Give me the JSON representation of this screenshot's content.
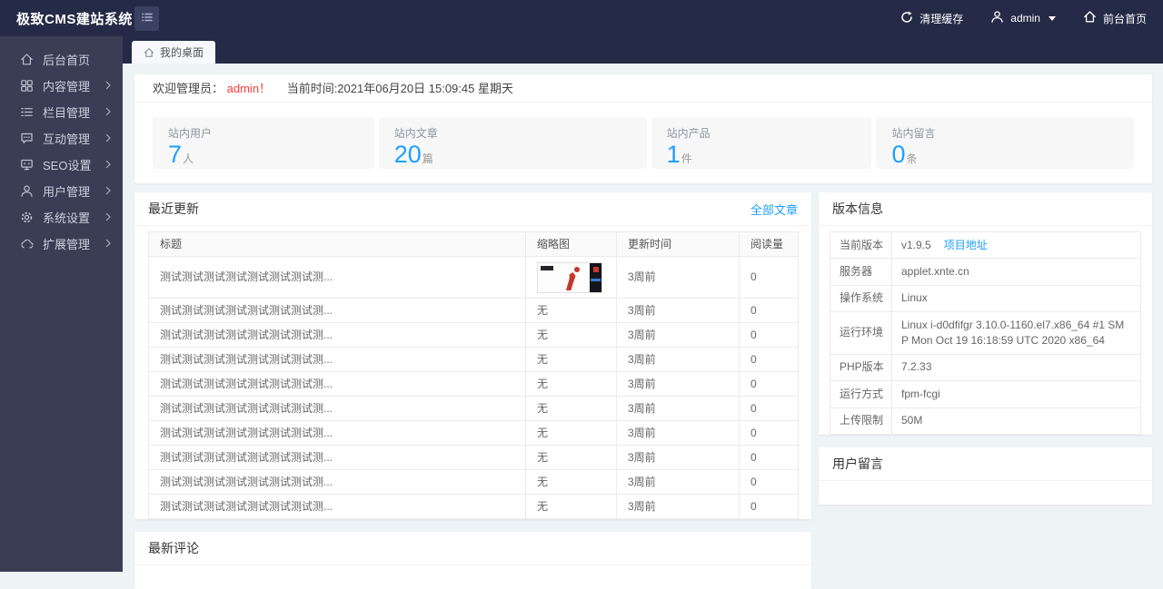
{
  "colors": {
    "accent": "#1E9FFF",
    "danger": "#ff3b3b",
    "topbar_bg": "#252a47",
    "sidebar_bg": "#3a3e54",
    "content_bg": "#eef3f6"
  },
  "topbar": {
    "logo": "极致CMS建站系统",
    "toggle_icon": "menu-list-icon",
    "clear_cache": {
      "label": "清理缓存",
      "icon": "refresh-icon"
    },
    "user": {
      "label": "admin",
      "icon": "user-icon",
      "caret": "caret-down-icon"
    },
    "front_home": {
      "label": "前台首页",
      "icon": "home-icon"
    }
  },
  "tabs": [
    {
      "label": "我的桌面",
      "icon": "home-icon"
    }
  ],
  "sidebar": {
    "items": [
      {
        "label": "后台首页",
        "icon": "home-icon",
        "has_children": false
      },
      {
        "label": "内容管理",
        "icon": "grid-icon",
        "has_children": true
      },
      {
        "label": "栏目管理",
        "icon": "list-icon",
        "has_children": true
      },
      {
        "label": "互动管理",
        "icon": "comment-icon",
        "has_children": true
      },
      {
        "label": "SEO设置",
        "icon": "monitor-icon",
        "has_children": true
      },
      {
        "label": "用户管理",
        "icon": "user-icon",
        "has_children": true
      },
      {
        "label": "系统设置",
        "icon": "gear-icon",
        "has_children": true
      },
      {
        "label": "扩展管理",
        "icon": "extension-icon",
        "has_children": true
      }
    ]
  },
  "welcome": {
    "prefix": "欢迎管理员：",
    "username": "admin！",
    "time_text": "当前时间:2021年06月20日 15:09:45 星期天"
  },
  "stats": [
    {
      "label": "站内用户",
      "value": "7",
      "unit": "人"
    },
    {
      "label": "站内文章",
      "value": "20",
      "unit": "篇"
    },
    {
      "label": "站内产品",
      "value": "1",
      "unit": "件"
    },
    {
      "label": "站内留言",
      "value": "0",
      "unit": "条"
    }
  ],
  "recent": {
    "title": "最近更新",
    "all_link": "全部文章",
    "columns": {
      "title": "标题",
      "thumb": "缩略图",
      "time": "更新时间",
      "reads": "阅读量"
    },
    "rows": [
      {
        "title": "测试测试测试测试测试测试测试测...",
        "has_image": true,
        "time": "3周前",
        "reads": "0"
      },
      {
        "title": "测试测试测试测试测试测试测试测...",
        "thumb": "无",
        "time": "3周前",
        "reads": "0"
      },
      {
        "title": "测试测试测试测试测试测试测试测...",
        "thumb": "无",
        "time": "3周前",
        "reads": "0"
      },
      {
        "title": "测试测试测试测试测试测试测试测...",
        "thumb": "无",
        "time": "3周前",
        "reads": "0"
      },
      {
        "title": "测试测试测试测试测试测试测试测...",
        "thumb": "无",
        "time": "3周前",
        "reads": "0"
      },
      {
        "title": "测试测试测试测试测试测试测试测...",
        "thumb": "无",
        "time": "3周前",
        "reads": "0"
      },
      {
        "title": "测试测试测试测试测试测试测试测...",
        "thumb": "无",
        "time": "3周前",
        "reads": "0"
      },
      {
        "title": "测试测试测试测试测试测试测试测...",
        "thumb": "无",
        "time": "3周前",
        "reads": "0"
      },
      {
        "title": "测试测试测试测试测试测试测试测...",
        "thumb": "无",
        "time": "3周前",
        "reads": "0"
      },
      {
        "title": "测试测试测试测试测试测试测试测...",
        "thumb": "无",
        "time": "3周前",
        "reads": "0"
      }
    ]
  },
  "version": {
    "title": "版本信息",
    "rows": [
      {
        "label": "当前版本",
        "value": "v1.9.5",
        "link": "项目地址"
      },
      {
        "label": "服务器",
        "value": "applet.xnte.cn"
      },
      {
        "label": "操作系统",
        "value": "Linux"
      },
      {
        "label": "运行环境",
        "value": "Linux i-d0dfifgr 3.10.0-1160.el7.x86_64 #1 SMP Mon Oct 19 16:18:59 UTC 2020 x86_64"
      },
      {
        "label": "PHP版本",
        "value": "7.2.33"
      },
      {
        "label": "运行方式",
        "value": "fpm-fcgi"
      },
      {
        "label": "上传限制",
        "value": "50M"
      }
    ]
  },
  "guestbook": {
    "title": "用户留言"
  },
  "comments": {
    "title": "最新评论"
  }
}
